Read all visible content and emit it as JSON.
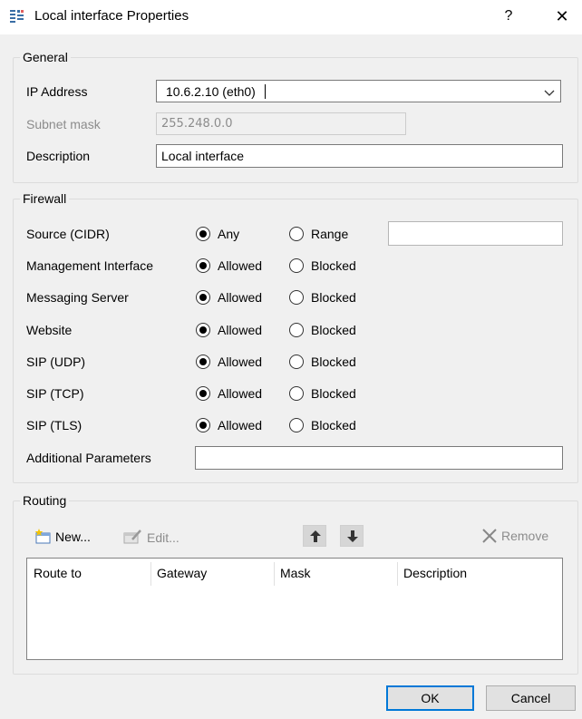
{
  "window": {
    "title": "Local interface Properties",
    "help_label": "?",
    "close_label": "✕"
  },
  "general": {
    "title": "General",
    "ip_label": "IP Address",
    "ip_value": "10.6.2.10 (eth0)",
    "subnet_label": "Subnet mask",
    "subnet_value": "255.248.0.0",
    "description_label": "Description",
    "description_value": "Local interface"
  },
  "firewall": {
    "title": "Firewall",
    "source": {
      "label": "Source (CIDR)",
      "option_a": "Any",
      "option_b": "Range",
      "selected": "Any",
      "range_value": ""
    },
    "rows": [
      {
        "label": "Management Interface",
        "allowed": "Allowed",
        "blocked": "Blocked",
        "selected": "Allowed"
      },
      {
        "label": "Messaging Server",
        "allowed": "Allowed",
        "blocked": "Blocked",
        "selected": "Allowed"
      },
      {
        "label": "Website",
        "allowed": "Allowed",
        "blocked": "Blocked",
        "selected": "Allowed"
      },
      {
        "label": "SIP (UDP)",
        "allowed": "Allowed",
        "blocked": "Blocked",
        "selected": "Allowed"
      },
      {
        "label": "SIP (TCP)",
        "allowed": "Allowed",
        "blocked": "Blocked",
        "selected": "Allowed"
      },
      {
        "label": "SIP (TLS)",
        "allowed": "Allowed",
        "blocked": "Blocked",
        "selected": "Allowed"
      }
    ],
    "additional_label": "Additional Parameters",
    "additional_value": ""
  },
  "routing": {
    "title": "Routing",
    "new_label": "New...",
    "edit_label": "Edit...",
    "remove_label": "Remove",
    "columns": [
      "Route to",
      "Gateway",
      "Mask",
      "Description"
    ],
    "rows": []
  },
  "footer": {
    "ok_label": "OK",
    "cancel_label": "Cancel"
  },
  "colors": {
    "accent": "#0078d7",
    "window_bg": "#f0f0f0"
  }
}
